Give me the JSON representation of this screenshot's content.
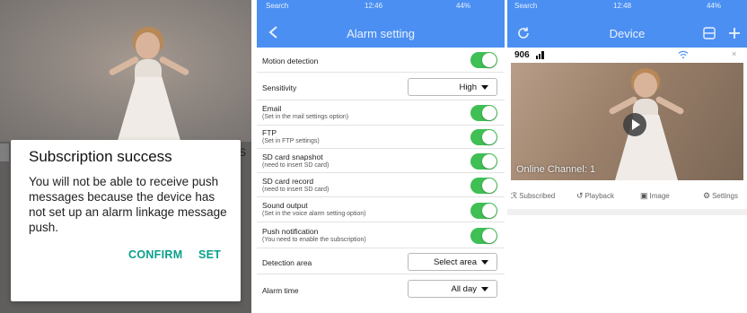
{
  "subscription_dialog": {
    "title": "Subscription success",
    "message": "You will not be able to receive push messages because the device has not set up an alarm linkage message push.",
    "confirm_label": "CONFIRM",
    "set_label": "SET"
  },
  "alarm_setting": {
    "status": {
      "carrier": "Search",
      "time": "12:46",
      "battery": "44%"
    },
    "title": "Alarm setting",
    "back_icon": "chevron-left-icon",
    "rows": [
      {
        "label": "Motion detection",
        "sub": "",
        "control": "toggle",
        "on": true
      },
      {
        "label": "Sensitivity",
        "sub": "",
        "control": "select",
        "value": "High"
      },
      {
        "label": "Email",
        "sub": "(Set in the mail settings option)",
        "control": "toggle",
        "on": true
      },
      {
        "label": "FTP",
        "sub": "(Set in FTP settings)",
        "control": "toggle",
        "on": true
      },
      {
        "label": "SD card snapshot",
        "sub": "(need to insert SD card)",
        "control": "toggle",
        "on": true
      },
      {
        "label": "SD card record",
        "sub": "(need to insert SD card)",
        "control": "toggle",
        "on": true
      },
      {
        "label": "Sound output",
        "sub": "(Set in the voice alarm setting option)",
        "control": "toggle",
        "on": true
      },
      {
        "label": "Push notification",
        "sub": "(You need to enable the subscription)",
        "control": "toggle",
        "on": true
      },
      {
        "label": "Detection area",
        "sub": "",
        "control": "select",
        "value": "Select area"
      },
      {
        "label": "Alarm time",
        "sub": "",
        "control": "select",
        "value": "All day"
      }
    ]
  },
  "device": {
    "status": {
      "carrier": "Search",
      "time": "12:48",
      "battery": "44%"
    },
    "title": "Device",
    "refresh_icon": "refresh-icon",
    "grid_icon": "grid-icon",
    "add_icon": "plus-icon",
    "device_name": "906",
    "channel_label": "Online Channel: 1",
    "actions": [
      {
        "label": "Subscribed",
        "icon": "subscribe-icon"
      },
      {
        "label": "Playback",
        "icon": "playback-icon"
      },
      {
        "label": "Image",
        "icon": "image-icon"
      },
      {
        "label": "Settings",
        "icon": "gear-icon"
      }
    ]
  },
  "colors": {
    "accent_teal": "#0a9f8a",
    "nav_blue": "#4b8ff2",
    "toggle_green": "#3fbf54"
  }
}
